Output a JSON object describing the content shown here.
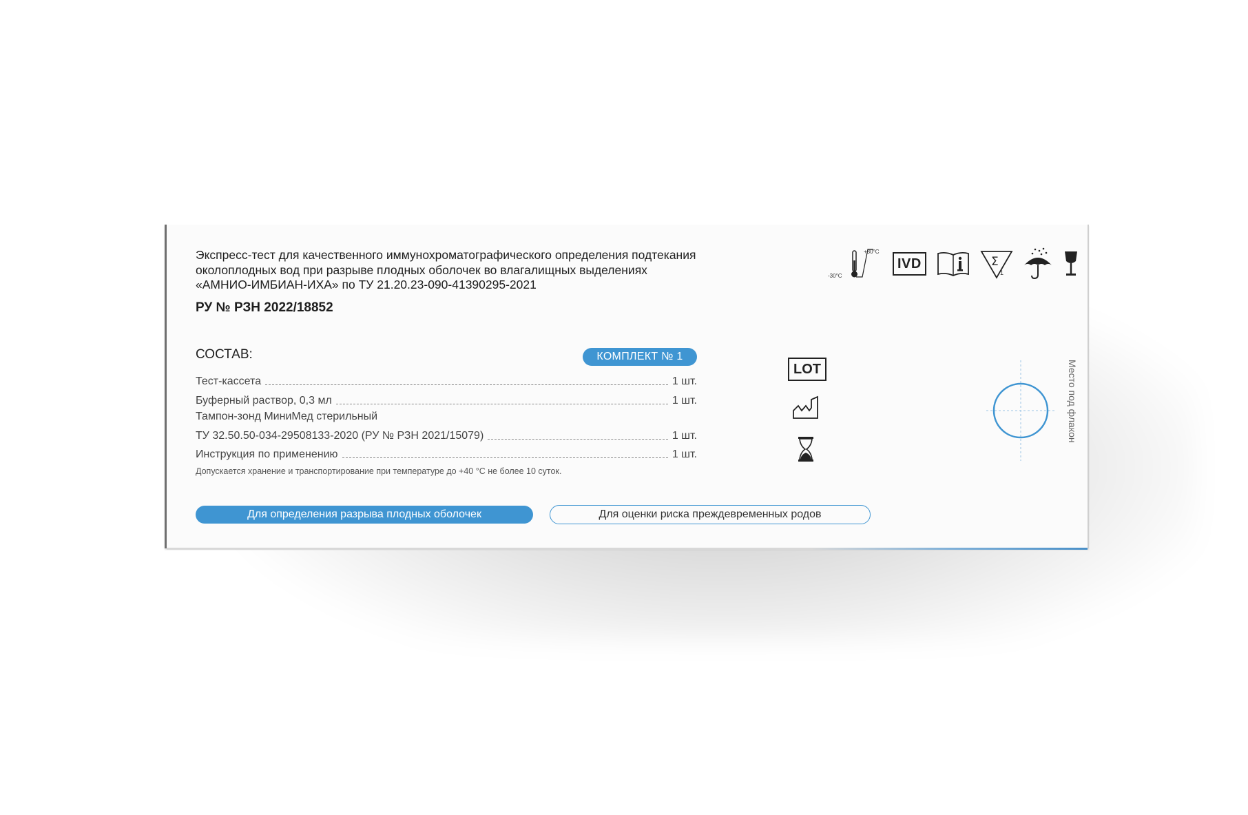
{
  "header": {
    "title_lines": [
      "Экспресс-тест для качественного иммунохроматографического определения подтекания",
      "околоплодных вод при разрыве плодных оболочек во влагалищных выделениях",
      "«АМНИО-ИМБИАН-ИХА» по ТУ 21.20.23-090-41390295-2021"
    ],
    "registration": "РУ № РЗН 2022/18852"
  },
  "symbols": {
    "temp_low": "-30°C",
    "temp_high": "+30°C",
    "ivd": "IVD",
    "sigma": "Σ",
    "sigma_count": "1"
  },
  "composition": {
    "heading": "СОСТАВ:",
    "kit_badge": "КОМПЛЕКТ № 1",
    "items": [
      {
        "label": "Тест-кассета",
        "qty": "1 шт."
      },
      {
        "label": "Буферный раствор, 0,3 мл",
        "qty": "1 шт."
      },
      {
        "label_line1": "Тампон-зонд МиниМед стерильный",
        "label": "ТУ 32.50.50-034-29508133-2020 (РУ № РЗН 2021/15079)",
        "qty": "1 шт."
      },
      {
        "label": "Инструкция по применению",
        "qty": "1 шт."
      }
    ],
    "storage_note": "Допускается хранение и транспортирование при температуре до +40 °С не более 10 суток."
  },
  "buttons": {
    "rupture": "Для определения разрыва плодных оболочек",
    "preterm": "Для оценки риска преждевременных родов"
  },
  "labels": {
    "lot": "LOT",
    "vial_place": "Место под флакон"
  },
  "colors": {
    "accent": "#3f95d2"
  }
}
